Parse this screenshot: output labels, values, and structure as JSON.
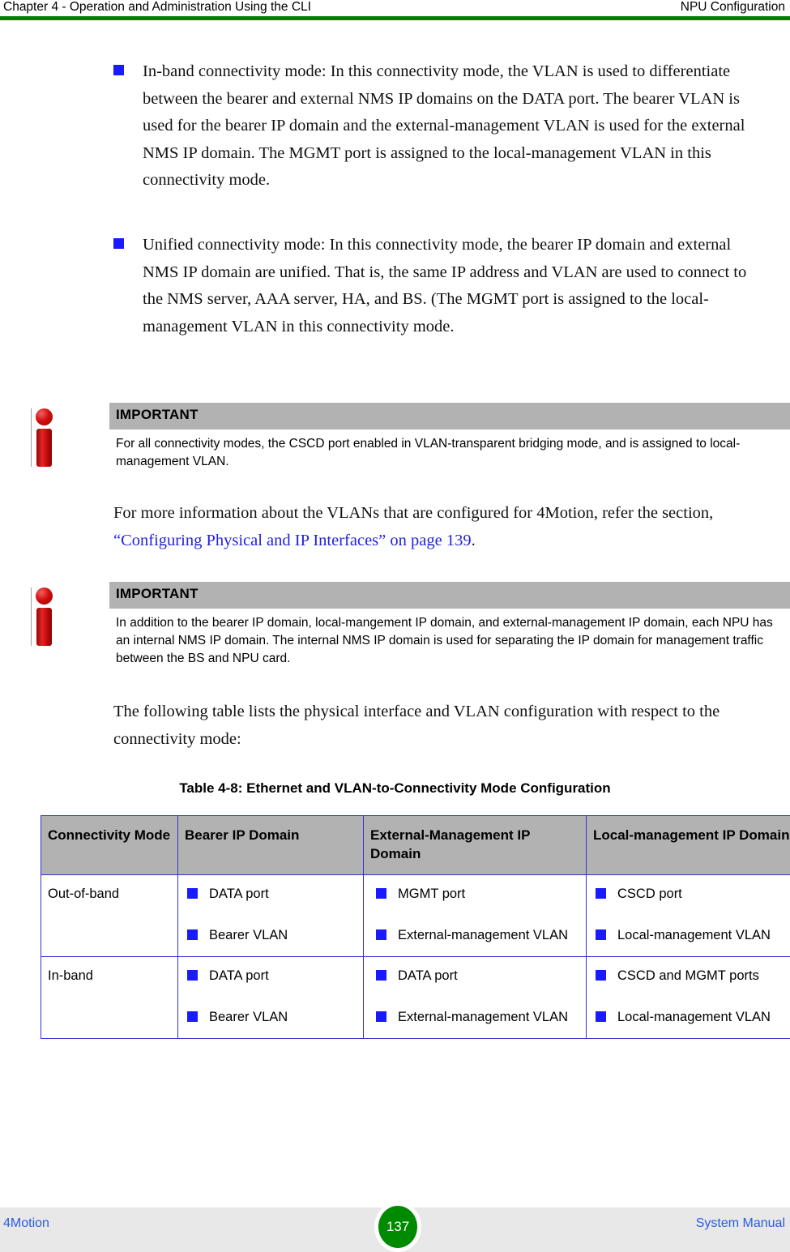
{
  "header": {
    "left": "Chapter 4 - Operation and Administration Using the CLI",
    "right": "NPU Configuration",
    "rule_color": "#008000"
  },
  "bullets": [
    {
      "name": "in-band-connectivity-mode",
      "text": "In-band connectivity mode: In this connectivity mode, the VLAN is used to differentiate between the bearer and external NMS IP domains on the DATA port. The bearer VLAN is used for the bearer IP domain and the external-management VLAN is used for the external NMS IP domain. The MGMT port is assigned to the local-management VLAN in this connectivity mode."
    },
    {
      "name": "unified-connectivity-mode",
      "text": "Unified connectivity mode: In this connectivity mode, the bearer IP domain and external NMS IP domain are unified. That is, the same IP address and VLAN are used to connect to the NMS server, AAA server, HA, and BS. (The MGMT port is assigned to the local-management VLAN in this connectivity mode."
    }
  ],
  "callouts": [
    {
      "title": "IMPORTANT",
      "body": "For all connectivity modes, the CSCD port enabled in VLAN-transparent bridging mode, and is assigned to local-management VLAN.",
      "icon": "info-icon",
      "header_bg": "#b2b2b2"
    },
    {
      "title": "IMPORTANT",
      "body": "In addition to the bearer IP domain, local-mangement IP domain, and external-management IP domain, each NPU has an internal NMS IP domain. The internal NMS IP domain is used for separating the IP domain for management traffic between the BS and NPU card.",
      "icon": "info-icon",
      "header_bg": "#b2b2b2"
    }
  ],
  "paragraphs": {
    "more_info_prefix": "For more information about the VLANs that are configured for 4Motion, refer the section, ",
    "more_info_link": "“Configuring Physical and IP Interfaces” on page 139",
    "more_info_suffix": ".",
    "link_color": "#2222dd",
    "following_table": "The following table lists the physical interface and VLAN configuration with respect to the connectivity mode:"
  },
  "table": {
    "caption": "Table 4-8: Ethernet and VLAN-to-Connectivity Mode Configuration",
    "border_color": "#3333cc",
    "header_bg": "#b2b2b2",
    "bullet_color": "#1a1aff",
    "columns": [
      "Connectivity Mode",
      "Bearer IP Domain",
      "External-Management IP Domain",
      "Local-management IP Domain"
    ],
    "rows": [
      {
        "mode": "Out-of-band",
        "bearer": [
          "DATA port",
          "Bearer VLAN"
        ],
        "external": [
          "MGMT port",
          "External-management VLAN"
        ],
        "local": [
          "CSCD port",
          "Local-management VLAN"
        ]
      },
      {
        "mode": "In-band",
        "bearer": [
          "DATA port",
          "Bearer VLAN"
        ],
        "external": [
          "DATA port",
          "External-management VLAN"
        ],
        "local": [
          "CSCD and MGMT ports",
          "Local-management VLAN"
        ]
      }
    ]
  },
  "footer": {
    "left": "4Motion",
    "page_number": "137",
    "right": "System Manual",
    "badge_color": "#008a00",
    "text_color": "#2b5ce0"
  }
}
